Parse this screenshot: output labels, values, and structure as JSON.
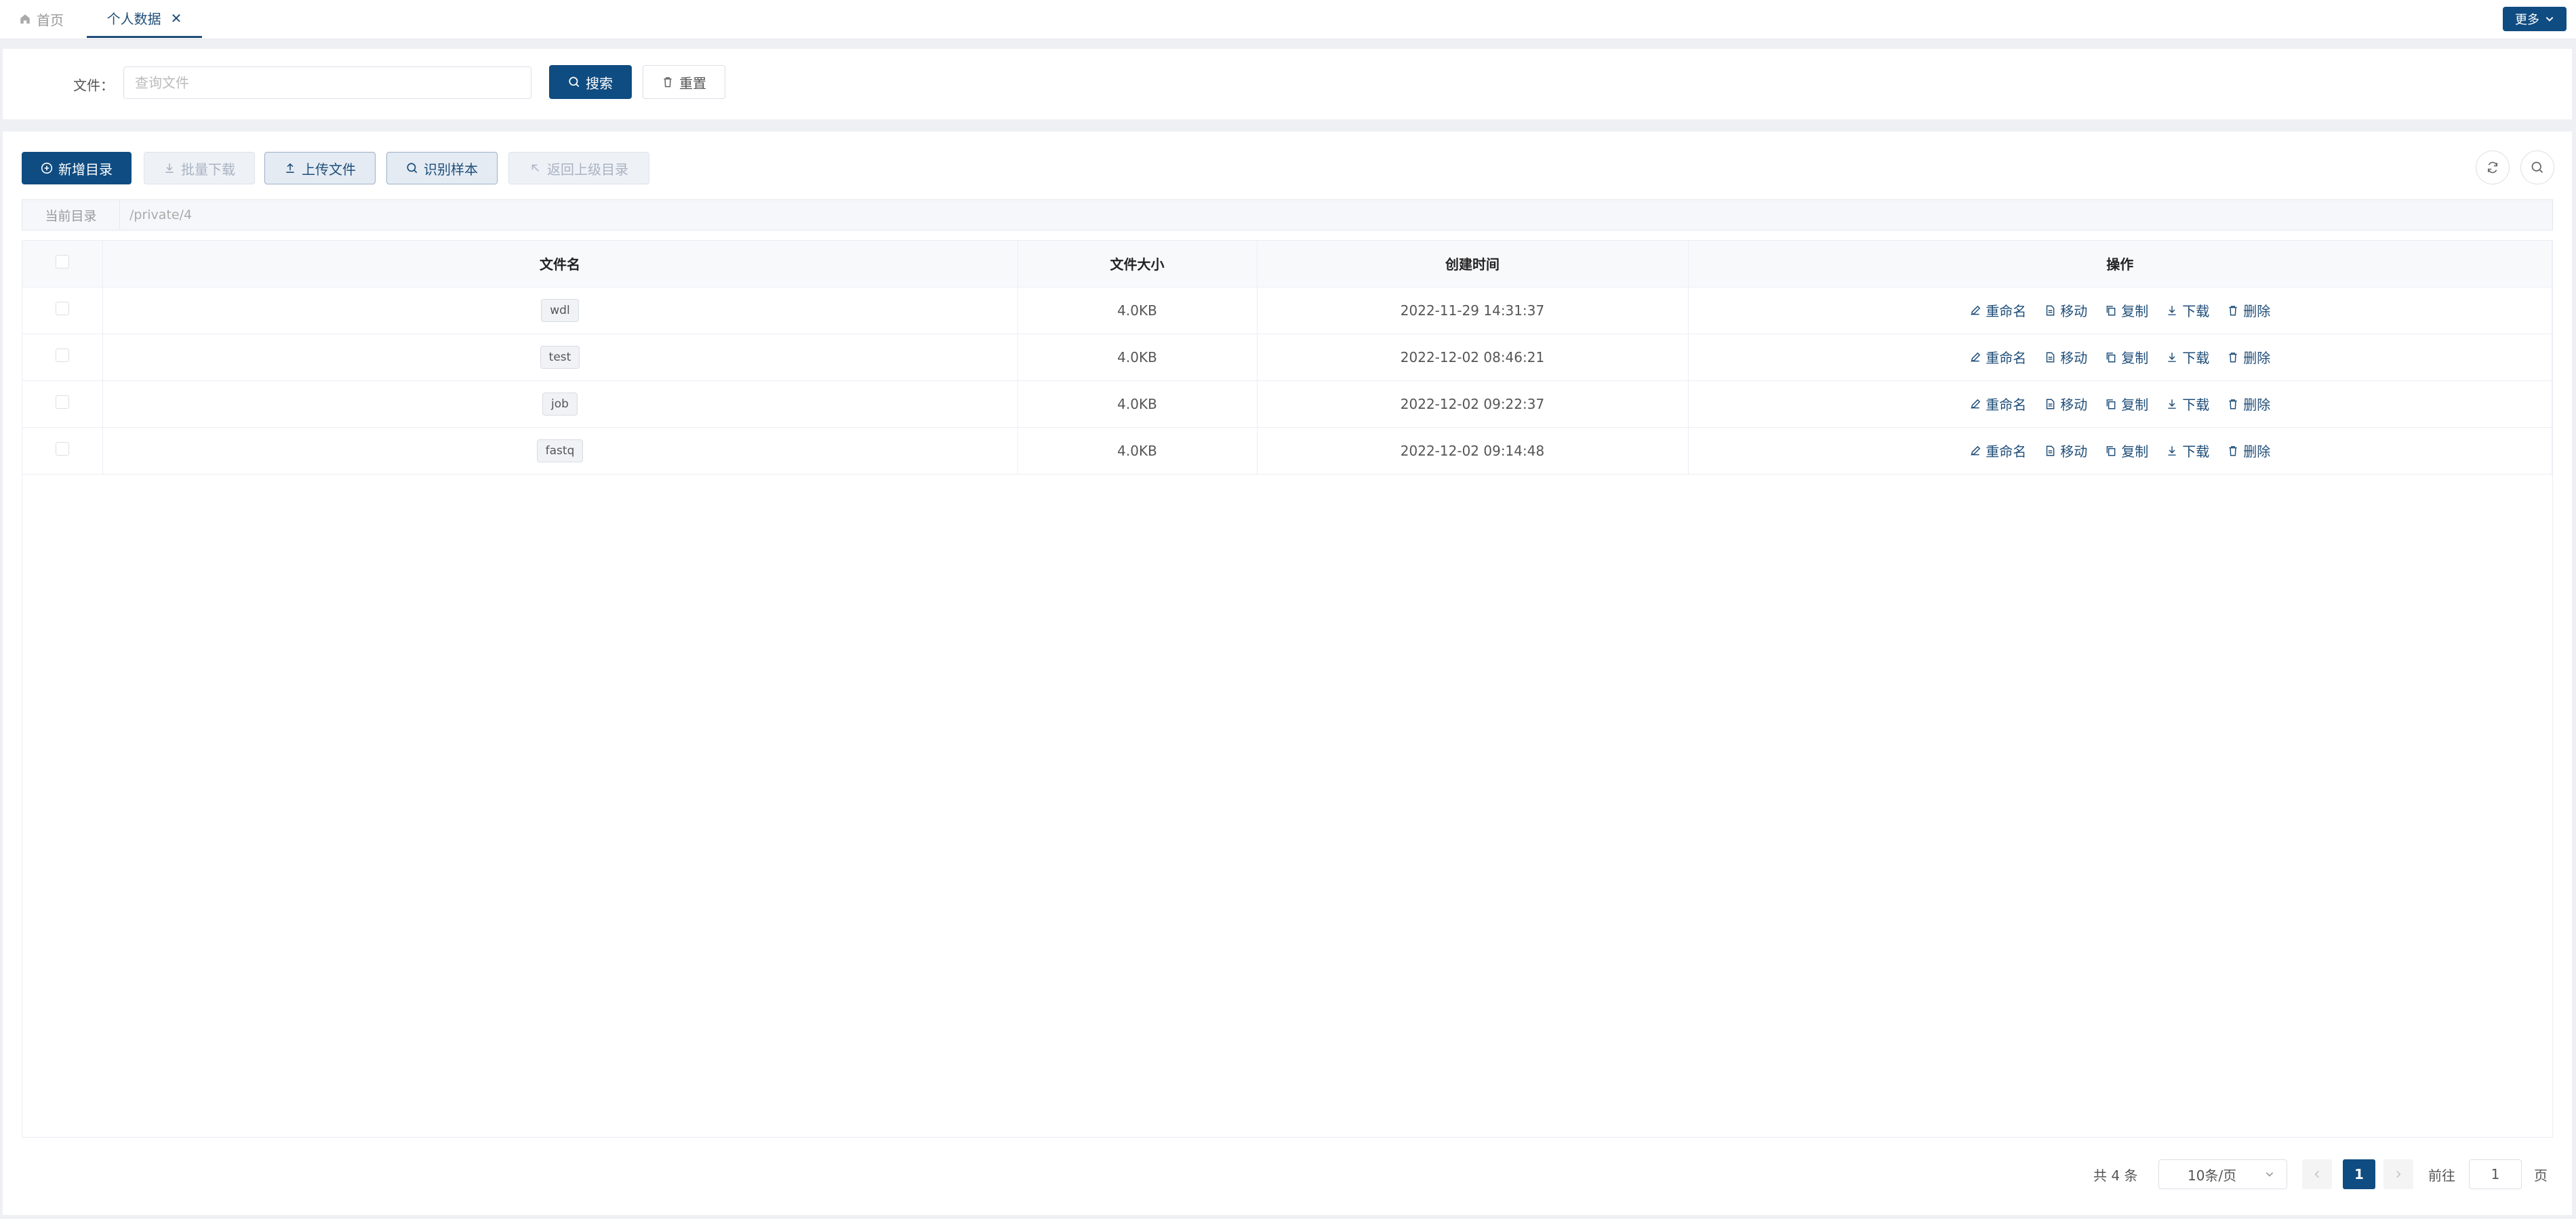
{
  "tabs": {
    "home_label": "首页",
    "active_label": "个人数据",
    "close_symbol": "✕",
    "more_label": "更多"
  },
  "search": {
    "label": "文件：",
    "placeholder": "查询文件",
    "value": "",
    "search_button": "搜索",
    "reset_button": "重置"
  },
  "toolbar": {
    "new_dir": "新增目录",
    "batch_download": "批量下载",
    "upload_file": "上传文件",
    "identify_sample": "识别样本",
    "return_parent": "返回上级目录"
  },
  "path": {
    "label": "当前目录",
    "value": "/private/4"
  },
  "table": {
    "headers": {
      "name": "文件名",
      "size": "文件大小",
      "created": "创建时间",
      "actions": "操作"
    },
    "action_labels": {
      "rename": "重命名",
      "move": "移动",
      "copy": "复制",
      "download": "下载",
      "delete": "删除"
    },
    "rows": [
      {
        "name": "wdl",
        "size": "4.0KB",
        "created": "2022-11-29 14:31:37"
      },
      {
        "name": "test",
        "size": "4.0KB",
        "created": "2022-12-02 08:46:21"
      },
      {
        "name": "job",
        "size": "4.0KB",
        "created": "2022-12-02 09:22:37"
      },
      {
        "name": "fastq",
        "size": "4.0KB",
        "created": "2022-12-02 09:14:48"
      }
    ]
  },
  "pagination": {
    "total": "共 4 条",
    "page_size": "10条/页",
    "current_page": "1",
    "goto_label": "前往",
    "goto_value": "1",
    "page_unit": "页"
  },
  "colors": {
    "primary": "#0f4c81",
    "link": "#1f4e79"
  }
}
